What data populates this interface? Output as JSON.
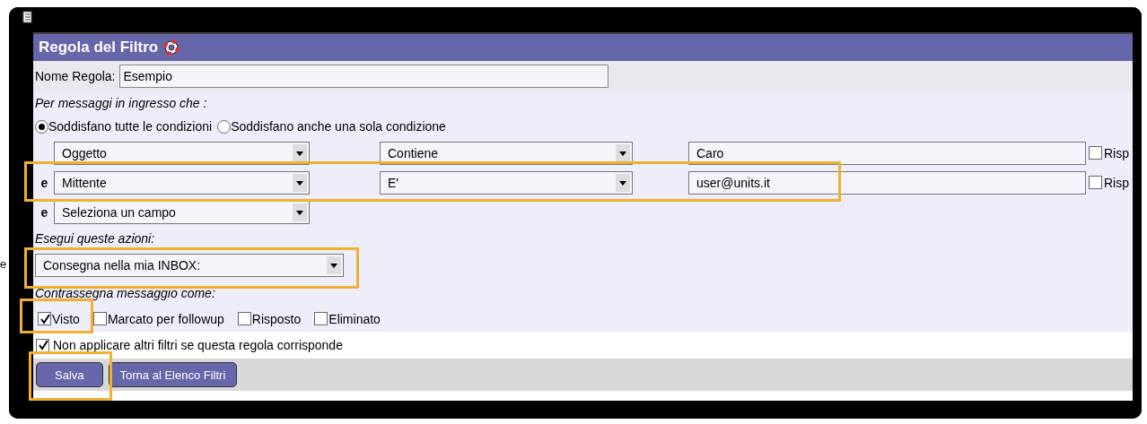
{
  "title": "Regola del Filtro",
  "rule_name": {
    "label": "Nome Regola:",
    "value": "Esempio"
  },
  "conditions_heading": "Per messaggi in ingresso che :",
  "match_options": [
    {
      "label": "Soddisfano tutte le condizioni",
      "selected": true
    },
    {
      "label": "Soddisfano anche una sola condizione",
      "selected": false
    }
  ],
  "conditions": [
    {
      "field": "Oggetto",
      "operator": "Contiene",
      "value": "Caro",
      "option": {
        "label": "Risp",
        "checked": false
      }
    },
    {
      "conjunction": "e",
      "field": "Mittente",
      "operator": "E'",
      "value": "user@units.it",
      "option": {
        "label": "Risp",
        "checked": false
      }
    },
    {
      "conjunction": "e",
      "field": "Seleziona un campo"
    }
  ],
  "actions_heading": "Esegui queste azioni:",
  "action": "Consegna nella mia INBOX:",
  "mark_heading": "Contrassegna messaggio come:",
  "flags": [
    {
      "label": "Visto",
      "checked": true
    },
    {
      "label": "Marcato per followup",
      "checked": false
    },
    {
      "label": "Risposto",
      "checked": false
    },
    {
      "label": "Eliminato",
      "checked": false
    }
  ],
  "stop": {
    "label": "Non applicare altri filtri se questa regola corrisponde",
    "checked": true
  },
  "buttons": [
    "Salva",
    "Torna al Elenco Filtri"
  ],
  "edge_text": "e"
}
